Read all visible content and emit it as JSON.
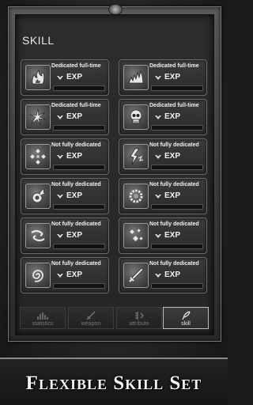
{
  "panel": {
    "title": "SKILL"
  },
  "skills": [
    {
      "status": "Dedicated full-time",
      "exp_label": "EXP",
      "icon": "fire-skill-icon"
    },
    {
      "status": "Dedicated full-time",
      "exp_label": "EXP",
      "icon": "spike-skill-icon"
    },
    {
      "status": "Dedicated full-time",
      "exp_label": "EXP",
      "icon": "burst-skill-icon"
    },
    {
      "status": "Dedicated full-time",
      "exp_label": "EXP",
      "icon": "skull-skill-icon"
    },
    {
      "status": "Not fully dedicated",
      "exp_label": "EXP",
      "icon": "dots-skill-icon"
    },
    {
      "status": "Not fully dedicated",
      "exp_label": "EXP",
      "icon": "lightning-skill-icon"
    },
    {
      "status": "Not fully dedicated",
      "exp_label": "EXP",
      "icon": "flame-orb-skill-icon"
    },
    {
      "status": "Not fully dedicated",
      "exp_label": "EXP",
      "icon": "ring-skill-icon"
    },
    {
      "status": "Not fully dedicated",
      "exp_label": "EXP",
      "icon": "wind-skill-icon"
    },
    {
      "status": "Not fully dedicated",
      "exp_label": "EXP",
      "icon": "sparkle-skill-icon"
    },
    {
      "status": "Not fully dedicated",
      "exp_label": "EXP",
      "icon": "vortex-skill-icon"
    },
    {
      "status": "Not fully dedicated",
      "exp_label": "EXP",
      "icon": "sword-skill-icon"
    }
  ],
  "tabs": [
    {
      "label": "statistics",
      "icon": "bars-icon",
      "active": false
    },
    {
      "label": "weapon",
      "icon": "sword-icon",
      "active": false
    },
    {
      "label": "attribute",
      "icon": "attribute-icon",
      "active": false
    },
    {
      "label": "skill",
      "icon": "quill-icon",
      "active": true
    }
  ],
  "banner": {
    "text": "Flexible Skill Set"
  }
}
